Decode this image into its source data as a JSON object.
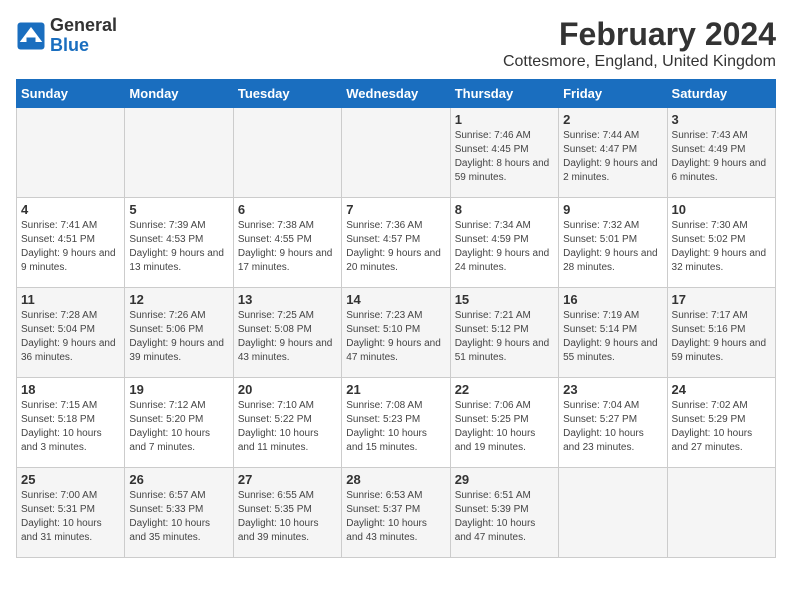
{
  "header": {
    "logo_general": "General",
    "logo_blue": "Blue",
    "month_title": "February 2024",
    "location": "Cottesmore, England, United Kingdom"
  },
  "weekdays": [
    "Sunday",
    "Monday",
    "Tuesday",
    "Wednesday",
    "Thursday",
    "Friday",
    "Saturday"
  ],
  "weeks": [
    [
      {
        "day": "",
        "sunrise": "",
        "sunset": "",
        "daylight": ""
      },
      {
        "day": "",
        "sunrise": "",
        "sunset": "",
        "daylight": ""
      },
      {
        "day": "",
        "sunrise": "",
        "sunset": "",
        "daylight": ""
      },
      {
        "day": "",
        "sunrise": "",
        "sunset": "",
        "daylight": ""
      },
      {
        "day": "1",
        "sunrise": "Sunrise: 7:46 AM",
        "sunset": "Sunset: 4:45 PM",
        "daylight": "Daylight: 8 hours and 59 minutes."
      },
      {
        "day": "2",
        "sunrise": "Sunrise: 7:44 AM",
        "sunset": "Sunset: 4:47 PM",
        "daylight": "Daylight: 9 hours and 2 minutes."
      },
      {
        "day": "3",
        "sunrise": "Sunrise: 7:43 AM",
        "sunset": "Sunset: 4:49 PM",
        "daylight": "Daylight: 9 hours and 6 minutes."
      }
    ],
    [
      {
        "day": "4",
        "sunrise": "Sunrise: 7:41 AM",
        "sunset": "Sunset: 4:51 PM",
        "daylight": "Daylight: 9 hours and 9 minutes."
      },
      {
        "day": "5",
        "sunrise": "Sunrise: 7:39 AM",
        "sunset": "Sunset: 4:53 PM",
        "daylight": "Daylight: 9 hours and 13 minutes."
      },
      {
        "day": "6",
        "sunrise": "Sunrise: 7:38 AM",
        "sunset": "Sunset: 4:55 PM",
        "daylight": "Daylight: 9 hours and 17 minutes."
      },
      {
        "day": "7",
        "sunrise": "Sunrise: 7:36 AM",
        "sunset": "Sunset: 4:57 PM",
        "daylight": "Daylight: 9 hours and 20 minutes."
      },
      {
        "day": "8",
        "sunrise": "Sunrise: 7:34 AM",
        "sunset": "Sunset: 4:59 PM",
        "daylight": "Daylight: 9 hours and 24 minutes."
      },
      {
        "day": "9",
        "sunrise": "Sunrise: 7:32 AM",
        "sunset": "Sunset: 5:01 PM",
        "daylight": "Daylight: 9 hours and 28 minutes."
      },
      {
        "day": "10",
        "sunrise": "Sunrise: 7:30 AM",
        "sunset": "Sunset: 5:02 PM",
        "daylight": "Daylight: 9 hours and 32 minutes."
      }
    ],
    [
      {
        "day": "11",
        "sunrise": "Sunrise: 7:28 AM",
        "sunset": "Sunset: 5:04 PM",
        "daylight": "Daylight: 9 hours and 36 minutes."
      },
      {
        "day": "12",
        "sunrise": "Sunrise: 7:26 AM",
        "sunset": "Sunset: 5:06 PM",
        "daylight": "Daylight: 9 hours and 39 minutes."
      },
      {
        "day": "13",
        "sunrise": "Sunrise: 7:25 AM",
        "sunset": "Sunset: 5:08 PM",
        "daylight": "Daylight: 9 hours and 43 minutes."
      },
      {
        "day": "14",
        "sunrise": "Sunrise: 7:23 AM",
        "sunset": "Sunset: 5:10 PM",
        "daylight": "Daylight: 9 hours and 47 minutes."
      },
      {
        "day": "15",
        "sunrise": "Sunrise: 7:21 AM",
        "sunset": "Sunset: 5:12 PM",
        "daylight": "Daylight: 9 hours and 51 minutes."
      },
      {
        "day": "16",
        "sunrise": "Sunrise: 7:19 AM",
        "sunset": "Sunset: 5:14 PM",
        "daylight": "Daylight: 9 hours and 55 minutes."
      },
      {
        "day": "17",
        "sunrise": "Sunrise: 7:17 AM",
        "sunset": "Sunset: 5:16 PM",
        "daylight": "Daylight: 9 hours and 59 minutes."
      }
    ],
    [
      {
        "day": "18",
        "sunrise": "Sunrise: 7:15 AM",
        "sunset": "Sunset: 5:18 PM",
        "daylight": "Daylight: 10 hours and 3 minutes."
      },
      {
        "day": "19",
        "sunrise": "Sunrise: 7:12 AM",
        "sunset": "Sunset: 5:20 PM",
        "daylight": "Daylight: 10 hours and 7 minutes."
      },
      {
        "day": "20",
        "sunrise": "Sunrise: 7:10 AM",
        "sunset": "Sunset: 5:22 PM",
        "daylight": "Daylight: 10 hours and 11 minutes."
      },
      {
        "day": "21",
        "sunrise": "Sunrise: 7:08 AM",
        "sunset": "Sunset: 5:23 PM",
        "daylight": "Daylight: 10 hours and 15 minutes."
      },
      {
        "day": "22",
        "sunrise": "Sunrise: 7:06 AM",
        "sunset": "Sunset: 5:25 PM",
        "daylight": "Daylight: 10 hours and 19 minutes."
      },
      {
        "day": "23",
        "sunrise": "Sunrise: 7:04 AM",
        "sunset": "Sunset: 5:27 PM",
        "daylight": "Daylight: 10 hours and 23 minutes."
      },
      {
        "day": "24",
        "sunrise": "Sunrise: 7:02 AM",
        "sunset": "Sunset: 5:29 PM",
        "daylight": "Daylight: 10 hours and 27 minutes."
      }
    ],
    [
      {
        "day": "25",
        "sunrise": "Sunrise: 7:00 AM",
        "sunset": "Sunset: 5:31 PM",
        "daylight": "Daylight: 10 hours and 31 minutes."
      },
      {
        "day": "26",
        "sunrise": "Sunrise: 6:57 AM",
        "sunset": "Sunset: 5:33 PM",
        "daylight": "Daylight: 10 hours and 35 minutes."
      },
      {
        "day": "27",
        "sunrise": "Sunrise: 6:55 AM",
        "sunset": "Sunset: 5:35 PM",
        "daylight": "Daylight: 10 hours and 39 minutes."
      },
      {
        "day": "28",
        "sunrise": "Sunrise: 6:53 AM",
        "sunset": "Sunset: 5:37 PM",
        "daylight": "Daylight: 10 hours and 43 minutes."
      },
      {
        "day": "29",
        "sunrise": "Sunrise: 6:51 AM",
        "sunset": "Sunset: 5:39 PM",
        "daylight": "Daylight: 10 hours and 47 minutes."
      },
      {
        "day": "",
        "sunrise": "",
        "sunset": "",
        "daylight": ""
      },
      {
        "day": "",
        "sunrise": "",
        "sunset": "",
        "daylight": ""
      }
    ]
  ]
}
